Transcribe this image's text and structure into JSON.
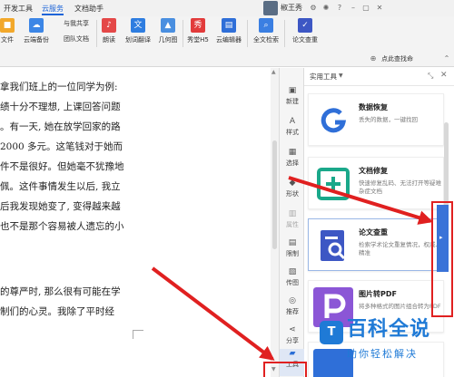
{
  "ribbon": {
    "tabs": [
      {
        "label": "开发工具"
      },
      {
        "label": "云服务"
      },
      {
        "label": "文档助手"
      }
    ],
    "user_name": "椒王秀",
    "buttons": [
      {
        "label": "文件"
      },
      {
        "label": "云端备份"
      },
      {
        "label": "与我共享"
      },
      {
        "label": "团队文档"
      },
      {
        "label": "朗读"
      },
      {
        "label": "划词翻译"
      },
      {
        "label": "几何图"
      },
      {
        "label": "秀堂H5"
      },
      {
        "label": "云编辑器"
      },
      {
        "label": "全文检索"
      },
      {
        "label": "论文查重"
      }
    ],
    "hint": "点此查找命"
  },
  "document": {
    "lines": [
      "拿我们班上的一位同学为例:",
      "绩十分不理想, 上课回答问题",
      "。有一天, 她在放学回家的路",
      "2000 多元。这笔钱对于她而",
      "件不是很好。但她毫不犹豫地",
      "佩。这件事情发生以后, 我立",
      "后我发现她变了, 变得越来越",
      "也不是那个容易被人遗忘的小",
      "的尊严时, 那么很有可能在学",
      "制们的心灵。我除了平时经"
    ]
  },
  "rail": {
    "items": [
      {
        "label": "新建"
      },
      {
        "label": "样式"
      },
      {
        "label": "选择"
      },
      {
        "label": "形状"
      },
      {
        "label": "属性"
      },
      {
        "label": "限制"
      },
      {
        "label": "传图"
      },
      {
        "label": "推荐"
      },
      {
        "label": "分享"
      },
      {
        "label": "工具"
      }
    ]
  },
  "panel": {
    "title": "实用工具",
    "cards": [
      {
        "title": "数据恢复",
        "desc": "丢失的数据，一键找回",
        "color": "#2f6fd8"
      },
      {
        "title": "文档修复",
        "desc": "快速修复乱码、无法打开等疑难杂症文档",
        "color": "#1aa88a"
      },
      {
        "title": "论文查重",
        "desc": "检索学术论文重复情况，权威、精准",
        "color": "#3d57c4"
      },
      {
        "title": "图片转PDF",
        "desc": "将多种格式的图片组合转为PDF",
        "color": "#8b56d6"
      }
    ]
  },
  "watermark": {
    "main": "百科全说",
    "sub": "助你轻松解决"
  },
  "colors": {
    "accent": "#1d64d8",
    "annotation": "#e02020",
    "watermark": "#1f7ad6"
  }
}
